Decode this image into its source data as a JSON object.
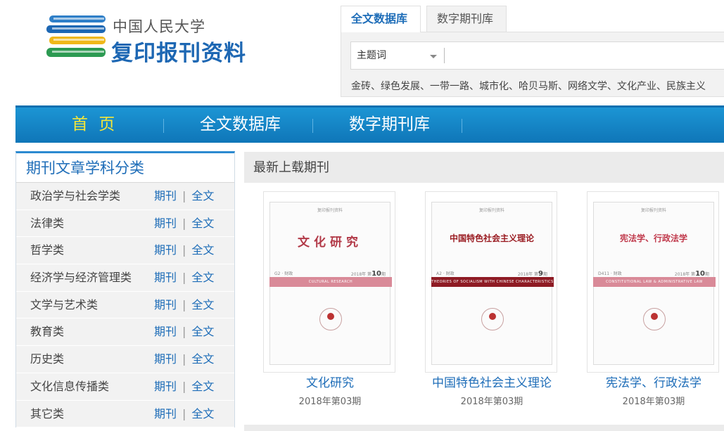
{
  "logo": {
    "top_text": "中国人民大学",
    "main_text": "复印报刊资料",
    "icon": "books-logo-icon"
  },
  "search": {
    "tabs": [
      {
        "label": "全文数据库",
        "active": true
      },
      {
        "label": "数字期刊库",
        "active": false
      }
    ],
    "select_value": "主题词",
    "input_value": "",
    "hot_words": "金砖、绿色发展、一带一路、城市化、哈贝马斯、网络文学、文化产业、民族主义"
  },
  "nav": {
    "items": [
      {
        "label": "首 页",
        "active": true
      },
      {
        "label": "全文数据库"
      },
      {
        "label": "数字期刊库"
      }
    ]
  },
  "sidebar": {
    "title": "期刊文章学科分类",
    "link_journal": "期刊",
    "link_fulltext": "全文",
    "separator": "|",
    "categories": [
      {
        "name": "政治学与社会学类"
      },
      {
        "name": "法律类"
      },
      {
        "name": "哲学类"
      },
      {
        "name": "经济学与经济管理类"
      },
      {
        "name": "文学与艺术类"
      },
      {
        "name": "教育类"
      },
      {
        "name": "历史类"
      },
      {
        "name": "文化信息传播类"
      },
      {
        "name": "其它类"
      }
    ]
  },
  "main": {
    "header": "最新上载期刊",
    "journals": [
      {
        "name": "文化研究",
        "issue": "2018年第03期",
        "cover": {
          "top": "复印报刊资料",
          "title": "文化研究",
          "code": "G2 · 财政",
          "year": "2018年 第",
          "no": "10",
          "unit": "期",
          "band_text": "CULTURAL RESEARCH",
          "band_color": "#d98a98",
          "title_color": "#b23a48"
        }
      },
      {
        "name": "中国特色社会主义理论",
        "issue": "2018年第03期",
        "cover": {
          "top": "复印报刊资料",
          "title": "中国特色社会主义理论",
          "code": "A2 · 财政",
          "year": "2018年 第",
          "no": "9",
          "unit": "期",
          "band_text": "THEORIES OF SOCIALISM WITH CHINESE CHARACTERISTICS",
          "band_color": "#8e1b24",
          "title_color": "#9a1c22"
        }
      },
      {
        "name": "宪法学、行政法学",
        "issue": "2018年第03期",
        "cover": {
          "top": "复印报刊资料",
          "title": "宪法学、行政法学",
          "code": "D411 · 财政",
          "year": "2018年 第",
          "no": "10",
          "unit": "期",
          "band_text": "CONSTITUTIONAL LAW & ADMINISTRATIVE LAW",
          "band_color": "#d98a98",
          "title_color": "#c0394b"
        }
      }
    ]
  }
}
